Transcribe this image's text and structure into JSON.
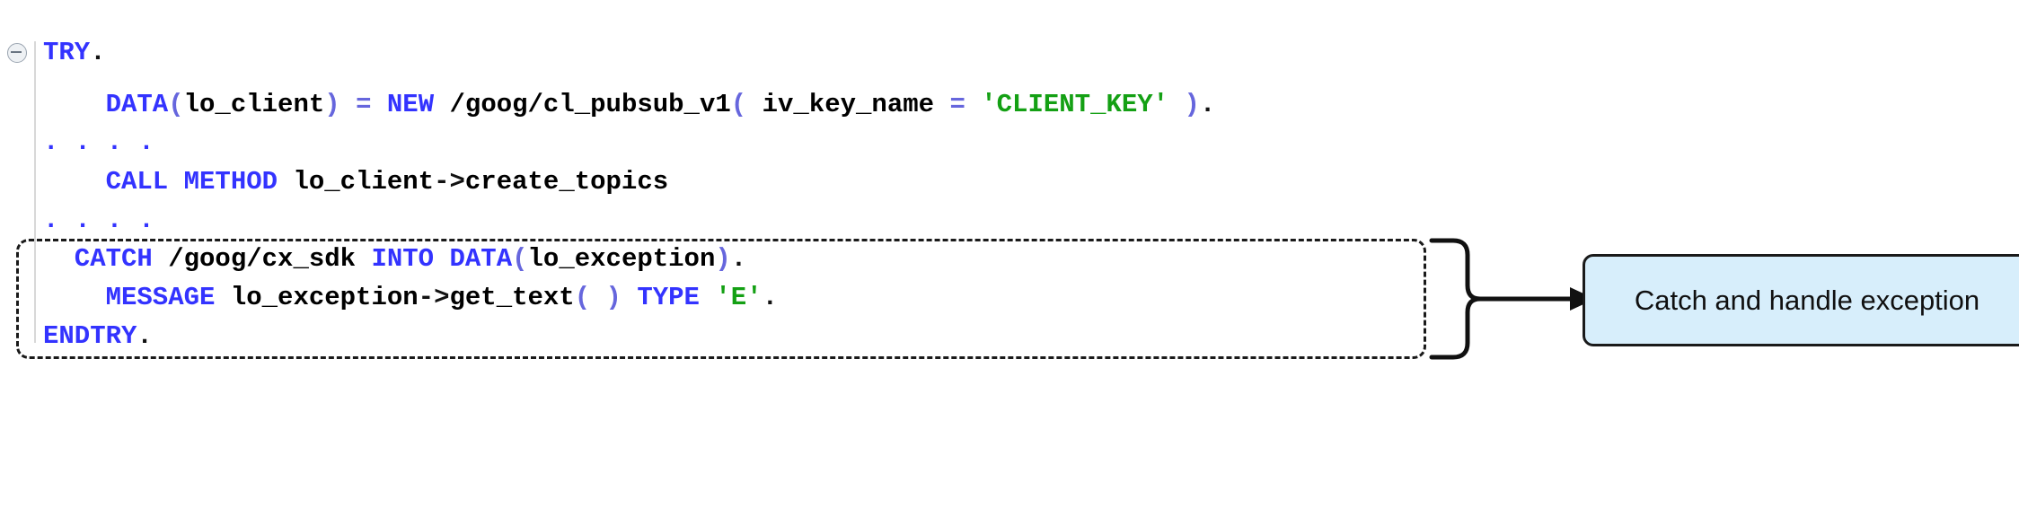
{
  "editor": {
    "language": "ABAP",
    "collapse_icon": "collapse-minus-icon",
    "lines": [
      {
        "id": "line-try",
        "indent": 0,
        "tokens": [
          {
            "t": "TRY",
            "c": "kw"
          },
          {
            "t": ".",
            "c": "pun"
          }
        ]
      },
      {
        "id": "line-data-new",
        "indent": 2,
        "tokens": [
          {
            "t": "DATA",
            "c": "kw"
          },
          {
            "t": "(",
            "c": "op"
          },
          {
            "t": "lo_client",
            "c": "pl"
          },
          {
            "t": ")",
            "c": "op"
          },
          {
            "t": " ",
            "c": "pl"
          },
          {
            "t": "=",
            "c": "op"
          },
          {
            "t": " ",
            "c": "pl"
          },
          {
            "t": "NEW",
            "c": "kw"
          },
          {
            "t": " ",
            "c": "pl"
          },
          {
            "t": "/goog/cl_pubsub_v1",
            "c": "pl"
          },
          {
            "t": "(",
            "c": "op"
          },
          {
            "t": " iv_key_name ",
            "c": "pl"
          },
          {
            "t": "=",
            "c": "op"
          },
          {
            "t": " ",
            "c": "pl"
          },
          {
            "t": "'CLIENT_KEY'",
            "c": "str"
          },
          {
            "t": " ",
            "c": "pl"
          },
          {
            "t": ")",
            "c": "op"
          },
          {
            "t": ".",
            "c": "pun"
          }
        ]
      },
      {
        "id": "line-call-method",
        "indent": 2,
        "tokens": [
          {
            "t": "CALL",
            "c": "kw"
          },
          {
            "t": " ",
            "c": "pl"
          },
          {
            "t": "METHOD",
            "c": "kw"
          },
          {
            "t": " ",
            "c": "pl"
          },
          {
            "t": "lo_client",
            "c": "pl"
          },
          {
            "t": "->",
            "c": "pun"
          },
          {
            "t": "create_topics",
            "c": "pl"
          }
        ]
      },
      {
        "id": "line-catch",
        "indent": 1,
        "tokens": [
          {
            "t": "CATCH",
            "c": "kw"
          },
          {
            "t": " ",
            "c": "pl"
          },
          {
            "t": "/goog/cx_sdk",
            "c": "pl"
          },
          {
            "t": " ",
            "c": "pl"
          },
          {
            "t": "INTO",
            "c": "kw"
          },
          {
            "t": " ",
            "c": "pl"
          },
          {
            "t": "DATA",
            "c": "kw"
          },
          {
            "t": "(",
            "c": "op"
          },
          {
            "t": "lo_exception",
            "c": "pl"
          },
          {
            "t": ")",
            "c": "op"
          },
          {
            "t": ".",
            "c": "pun"
          }
        ]
      },
      {
        "id": "line-message",
        "indent": 2,
        "tokens": [
          {
            "t": "MESSAGE",
            "c": "kw"
          },
          {
            "t": " ",
            "c": "pl"
          },
          {
            "t": "lo_exception",
            "c": "pl"
          },
          {
            "t": "->",
            "c": "pun"
          },
          {
            "t": "get_text",
            "c": "pl"
          },
          {
            "t": "( )",
            "c": "op"
          },
          {
            "t": " ",
            "c": "pl"
          },
          {
            "t": "TYPE",
            "c": "kw"
          },
          {
            "t": " ",
            "c": "pl"
          },
          {
            "t": "'E'",
            "c": "str"
          },
          {
            "t": ".",
            "c": "pun"
          }
        ]
      },
      {
        "id": "line-endtry",
        "indent": 0,
        "tokens": [
          {
            "t": "ENDTRY",
            "c": "kw"
          },
          {
            "t": ".",
            "c": "pun"
          }
        ]
      }
    ],
    "dot_rows": [
      {
        "id": "dot-row-1",
        "text": "...."
      },
      {
        "id": "dot-row-2",
        "text": "...."
      }
    ]
  },
  "annotation": {
    "callout_label": "Catch and handle exception",
    "callout_fill": "#d7eefb",
    "callout_border": "#1a1a1a",
    "highlight_border": "#1a1a1a",
    "highlight_style": "dashed",
    "connector": "brace-arrow"
  },
  "colors": {
    "keyword": "#3333ff",
    "identifier": "#000000",
    "string": "#14a014",
    "operator": "#6666dd",
    "background": "#ffffff",
    "gutter_rule": "#d8d8d8"
  }
}
